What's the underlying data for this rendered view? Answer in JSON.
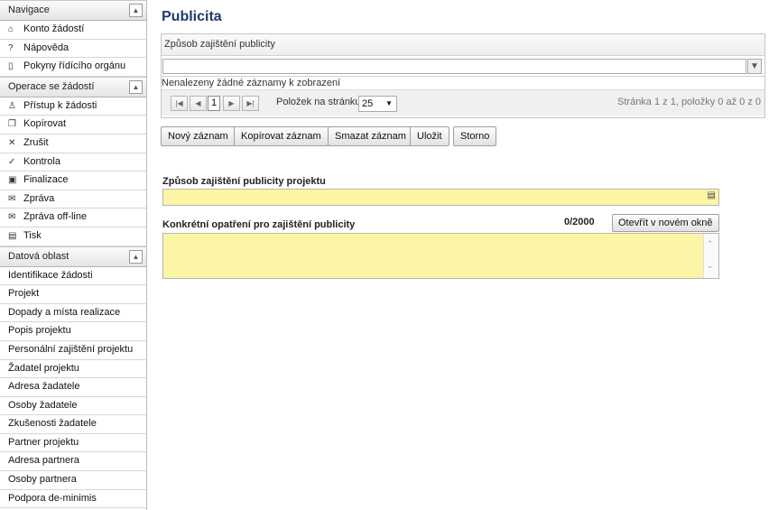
{
  "sidebar": {
    "sections": [
      {
        "title": "Navigace",
        "collapse": "▲",
        "items": [
          {
            "icon": "home-icon",
            "glyph": "⌂",
            "label": "Konto žádostí"
          },
          {
            "icon": "help-icon",
            "glyph": "?",
            "label": "Nápověda"
          },
          {
            "icon": "book-icon",
            "glyph": "▯",
            "label": "Pokyny řídícího orgánu"
          }
        ]
      },
      {
        "title": "Operace se žádostí",
        "collapse": "▲",
        "items": [
          {
            "icon": "user-icon",
            "glyph": "♙",
            "label": "Přístup k žádosti"
          },
          {
            "icon": "copy-icon",
            "glyph": "❐",
            "label": "Kopírovat"
          },
          {
            "icon": "cancel-icon",
            "glyph": "✕",
            "label": "Zrušit"
          },
          {
            "icon": "check-icon",
            "glyph": "✓",
            "label": "Kontrola"
          },
          {
            "icon": "lock-icon",
            "glyph": "▣",
            "label": "Finalizace"
          },
          {
            "icon": "mail-icon",
            "glyph": "✉",
            "label": "Zpráva"
          },
          {
            "icon": "mail-offline-icon",
            "glyph": "✉",
            "label": "Zpráva off-line"
          },
          {
            "icon": "print-icon",
            "glyph": "▤",
            "label": "Tisk"
          }
        ]
      },
      {
        "title": "Datová oblast",
        "collapse": "▲",
        "items": [
          {
            "label": "Identifikace žádosti"
          },
          {
            "label": "Projekt"
          },
          {
            "label": "Dopady a místa realizace"
          },
          {
            "label": "Popis projektu"
          },
          {
            "label": "Personální zajištění projektu"
          },
          {
            "label": "Žadatel projektu"
          },
          {
            "label": "Adresa žadatele"
          },
          {
            "label": "Osoby žadatele"
          },
          {
            "label": "Zkušenosti žadatele"
          },
          {
            "label": "Partner projektu"
          },
          {
            "label": "Adresa partnera"
          },
          {
            "label": "Osoby partnera"
          },
          {
            "label": "Podpora de-minimis"
          }
        ]
      }
    ]
  },
  "main": {
    "title": "Publicita",
    "grid": {
      "column_header": "Způsob zajištění publicity",
      "filter_value": "",
      "empty_message": "Nenalezeny žádné záznamy k zobrazení",
      "pager": {
        "current_page": "1",
        "page_size_label": "Položek na stránku",
        "page_size": "25",
        "status": "Stránka 1 z 1, položky 0 až 0 z 0"
      }
    },
    "buttons": {
      "new": "Nový záznam",
      "copy": "Kopírovat záznam",
      "delete": "Smazat záznam",
      "save": "Uložit",
      "cancel": "Storno"
    },
    "form": {
      "method_label": "Způsob zajištění publicity projektu",
      "method_value": "",
      "measures_label": "Konkrétní opatření pro zajištění publicity",
      "counter": "0/2000",
      "open_window": "Otevřít v novém okně",
      "measures_value": ""
    }
  },
  "colors": {
    "title": "#1f3a6e",
    "required_field": "#fbf5a5"
  }
}
